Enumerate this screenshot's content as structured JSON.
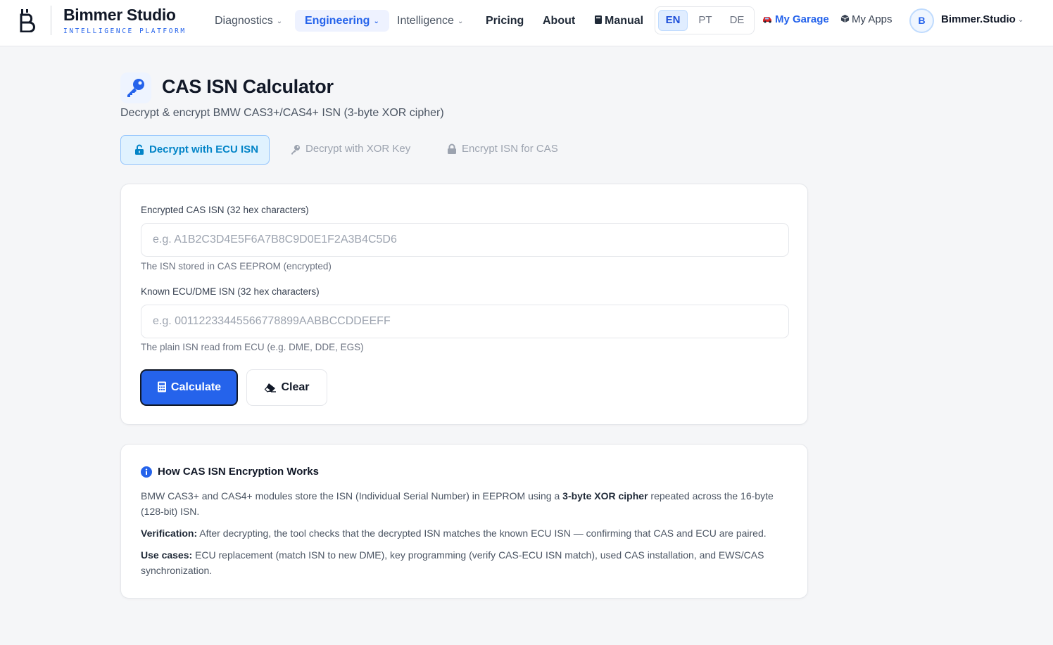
{
  "header": {
    "brand_name": "Bimmer Studio",
    "brand_tagline": "INTELLIGENCE PLATFORM",
    "nav": {
      "diagnostics": "Diagnostics",
      "engineering": "Engineering",
      "intelligence": "Intelligence",
      "pricing": "Pricing",
      "about": "About",
      "manual": "Manual"
    },
    "languages": [
      "EN",
      "PT",
      "DE"
    ],
    "active_language": "EN",
    "my_garage": "My Garage",
    "my_apps": "My Apps",
    "user": {
      "initial": "B",
      "name": "Bimmer.Studio"
    }
  },
  "page": {
    "title": "CAS ISN Calculator",
    "subtitle": "Decrypt & encrypt BMW CAS3+/CAS4+ ISN (3-byte XOR cipher)"
  },
  "tabs": [
    {
      "label": "Decrypt with ECU ISN",
      "active": true
    },
    {
      "label": "Decrypt with XOR Key",
      "active": false
    },
    {
      "label": "Encrypt ISN for CAS",
      "active": false
    }
  ],
  "form": {
    "encrypted_label": "Encrypted CAS ISN (32 hex characters)",
    "encrypted_placeholder": "e.g. A1B2C3D4E5F6A7B8C9D0E1F2A3B4C5D6",
    "encrypted_value": "",
    "encrypted_help": "The ISN stored in CAS EEPROM (encrypted)",
    "ecu_label": "Known ECU/DME ISN (32 hex characters)",
    "ecu_placeholder": "e.g. 00112233445566778899AABBCCDDEEFF",
    "ecu_value": "",
    "ecu_help": "The plain ISN read from ECU (e.g. DME, DDE, EGS)",
    "calculate_label": "Calculate",
    "clear_label": "Clear"
  },
  "info": {
    "title": "How CAS ISN Encryption Works",
    "p1_a": "BMW CAS3+ and CAS4+ modules store the ISN (Individual Serial Number) in EEPROM using a ",
    "p1_bold": "3-byte XOR cipher",
    "p1_b": " repeated across the 16-byte (128-bit) ISN.",
    "p2_bold": "Verification:",
    "p2_text": " After decrypting, the tool checks that the decrypted ISN matches the known ECU ISN — confirming that CAS and ECU are paired.",
    "p3_bold": "Use cases:",
    "p3_text": " ECU replacement (match ISN to new DME), key programming (verify CAS-ECU ISN match), used CAS installation, and EWS/CAS synchronization."
  },
  "colors": {
    "accent": "#2563eb",
    "tab_active_bg": "#e0f2fe",
    "tab_active_text": "#0284c7",
    "page_bg": "#f5f6f8"
  },
  "icons": {
    "title": "key-icon",
    "tab_1": "unlock-icon",
    "tab_2": "key-icon",
    "tab_3": "lock-icon",
    "calculate": "calculator-icon",
    "clear": "eraser-icon",
    "info": "info-icon",
    "garage": "car-icon",
    "apps": "cube-icon",
    "manual": "book-icon"
  }
}
